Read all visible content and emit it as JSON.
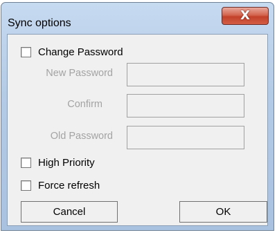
{
  "window": {
    "title": "Sync options",
    "close_glyph": "X",
    "close_icon": "close-icon"
  },
  "change_password": {
    "label": "Change Password",
    "checked": false
  },
  "fields": {
    "new_password": {
      "label": "New Password",
      "value": ""
    },
    "confirm": {
      "label": "Confirm",
      "value": ""
    },
    "old_password": {
      "label": "Old Password",
      "value": ""
    }
  },
  "options": {
    "high_priority": {
      "label": "High Priority",
      "checked": false
    },
    "force_refresh": {
      "label": "Force refresh",
      "checked": false
    }
  },
  "buttons": {
    "cancel": "Cancel",
    "ok": "OK"
  },
  "colors": {
    "frame": "#b4cbe6",
    "close_button": "#c2412a",
    "disabled_text": "#a3a3a3",
    "client_background": "#f0f0f0"
  }
}
